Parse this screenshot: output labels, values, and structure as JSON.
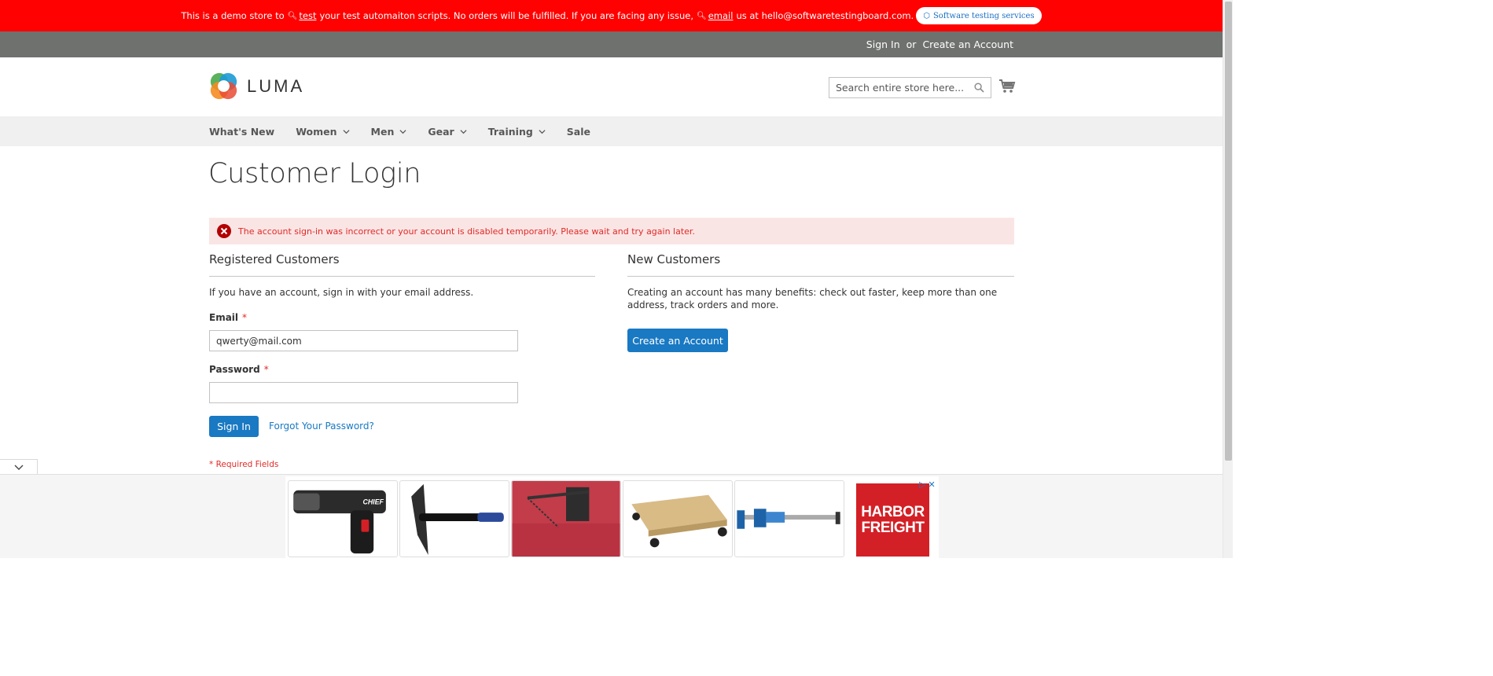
{
  "demo_banner": {
    "text_1": "This is a demo store to",
    "link_test": "test",
    "text_2": "your test automaiton scripts. No orders will be fulfilled. If you are facing any issue,",
    "link_email": "email",
    "text_3": "us at hello@softwaretestingboard.com.",
    "services_button": "Software testing services"
  },
  "header_links": {
    "sign_in": "Sign In",
    "or": "or",
    "create_account": "Create an Account"
  },
  "logo": {
    "text": "LUMA"
  },
  "search": {
    "placeholder": "Search entire store here..."
  },
  "nav": {
    "items": [
      {
        "label": "What's New",
        "has_menu": false
      },
      {
        "label": "Women",
        "has_menu": true
      },
      {
        "label": "Men",
        "has_menu": true
      },
      {
        "label": "Gear",
        "has_menu": true
      },
      {
        "label": "Training",
        "has_menu": true
      },
      {
        "label": "Sale",
        "has_menu": false
      }
    ]
  },
  "page_title": "Customer Login",
  "error_message": "The account sign-in was incorrect or your account is disabled temporarily. Please wait and try again later.",
  "registered": {
    "title": "Registered Customers",
    "intro": "If you have an account, sign in with your email address.",
    "email_label": "Email",
    "email_value": "qwerty@mail.com",
    "password_label": "Password",
    "password_value": "",
    "required_mark": "*",
    "sign_in_button": "Sign In",
    "forgot_link": "Forgot Your Password?",
    "required_note": "* Required Fields"
  },
  "new_customers": {
    "title": "New Customers",
    "intro": "Creating an account has many benefits: check out faster, keep more than one address, track orders and more.",
    "create_button": "Create an Account"
  },
  "ad": {
    "brand_line_1": "HARBOR",
    "brand_line_2": "FREIGHT"
  },
  "colors": {
    "demo_banner_bg": "#ff0101",
    "panel_bg": "#6e716e",
    "primary_button": "#1979c3",
    "error_bg": "#fae5e5",
    "error_text": "#e02b27"
  }
}
